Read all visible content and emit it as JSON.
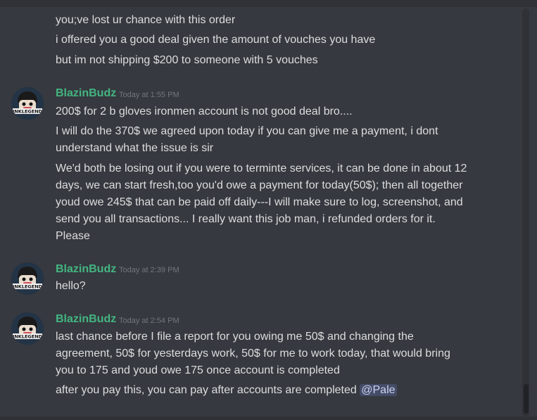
{
  "channel_messages": {
    "continuation": [
      "you;ve lost ur chance with this order",
      "i offered you a good deal given the amount of vouches you have",
      "but im not shipping $200 to someone with 5 vouches"
    ],
    "groups": [
      {
        "author": "BlazinBudz",
        "timestamp": "Today at 1:55 PM",
        "lines": [
          "200$ for 2 b gloves ironmen account is not good deal bro....",
          "I will do the 370$ we agreed upon today if you can give me a payment, i dont",
          "understand what the issue is sir",
          "We'd both be losing out if you were to terminte services, it can be done in about 12",
          "days, we can start fresh,too you'd owe a payment for today(50$); then all together",
          "youd owe 245$ that can be paid off daily---I will make sure to log, screenshot, and",
          "send you all transactions... I really want this job man, i refunded  orders for it.",
          "Please"
        ]
      },
      {
        "author": "BlazinBudz",
        "timestamp": "Today at 2:39 PM",
        "lines": [
          "hello?"
        ]
      },
      {
        "author": "BlazinBudz",
        "timestamp": "Today at 2:54 PM",
        "lines": [
          "last chance before I file a report for you owing me 50$ and changing the",
          "agreement, 50$ for yesterdays work, 50$ for me to work today, that would bring",
          "you to 175 and youd owe 175 once account is completed",
          "after you pay this, you can pay after accounts are completed "
        ],
        "mention": "@Pale"
      }
    ]
  },
  "avatar_text": "INKLEGEND",
  "colors": {
    "background": "#36393f",
    "username": "#43b581",
    "text": "#dcddde",
    "timestamp": "#72767d",
    "mention_bg": "#414675"
  }
}
